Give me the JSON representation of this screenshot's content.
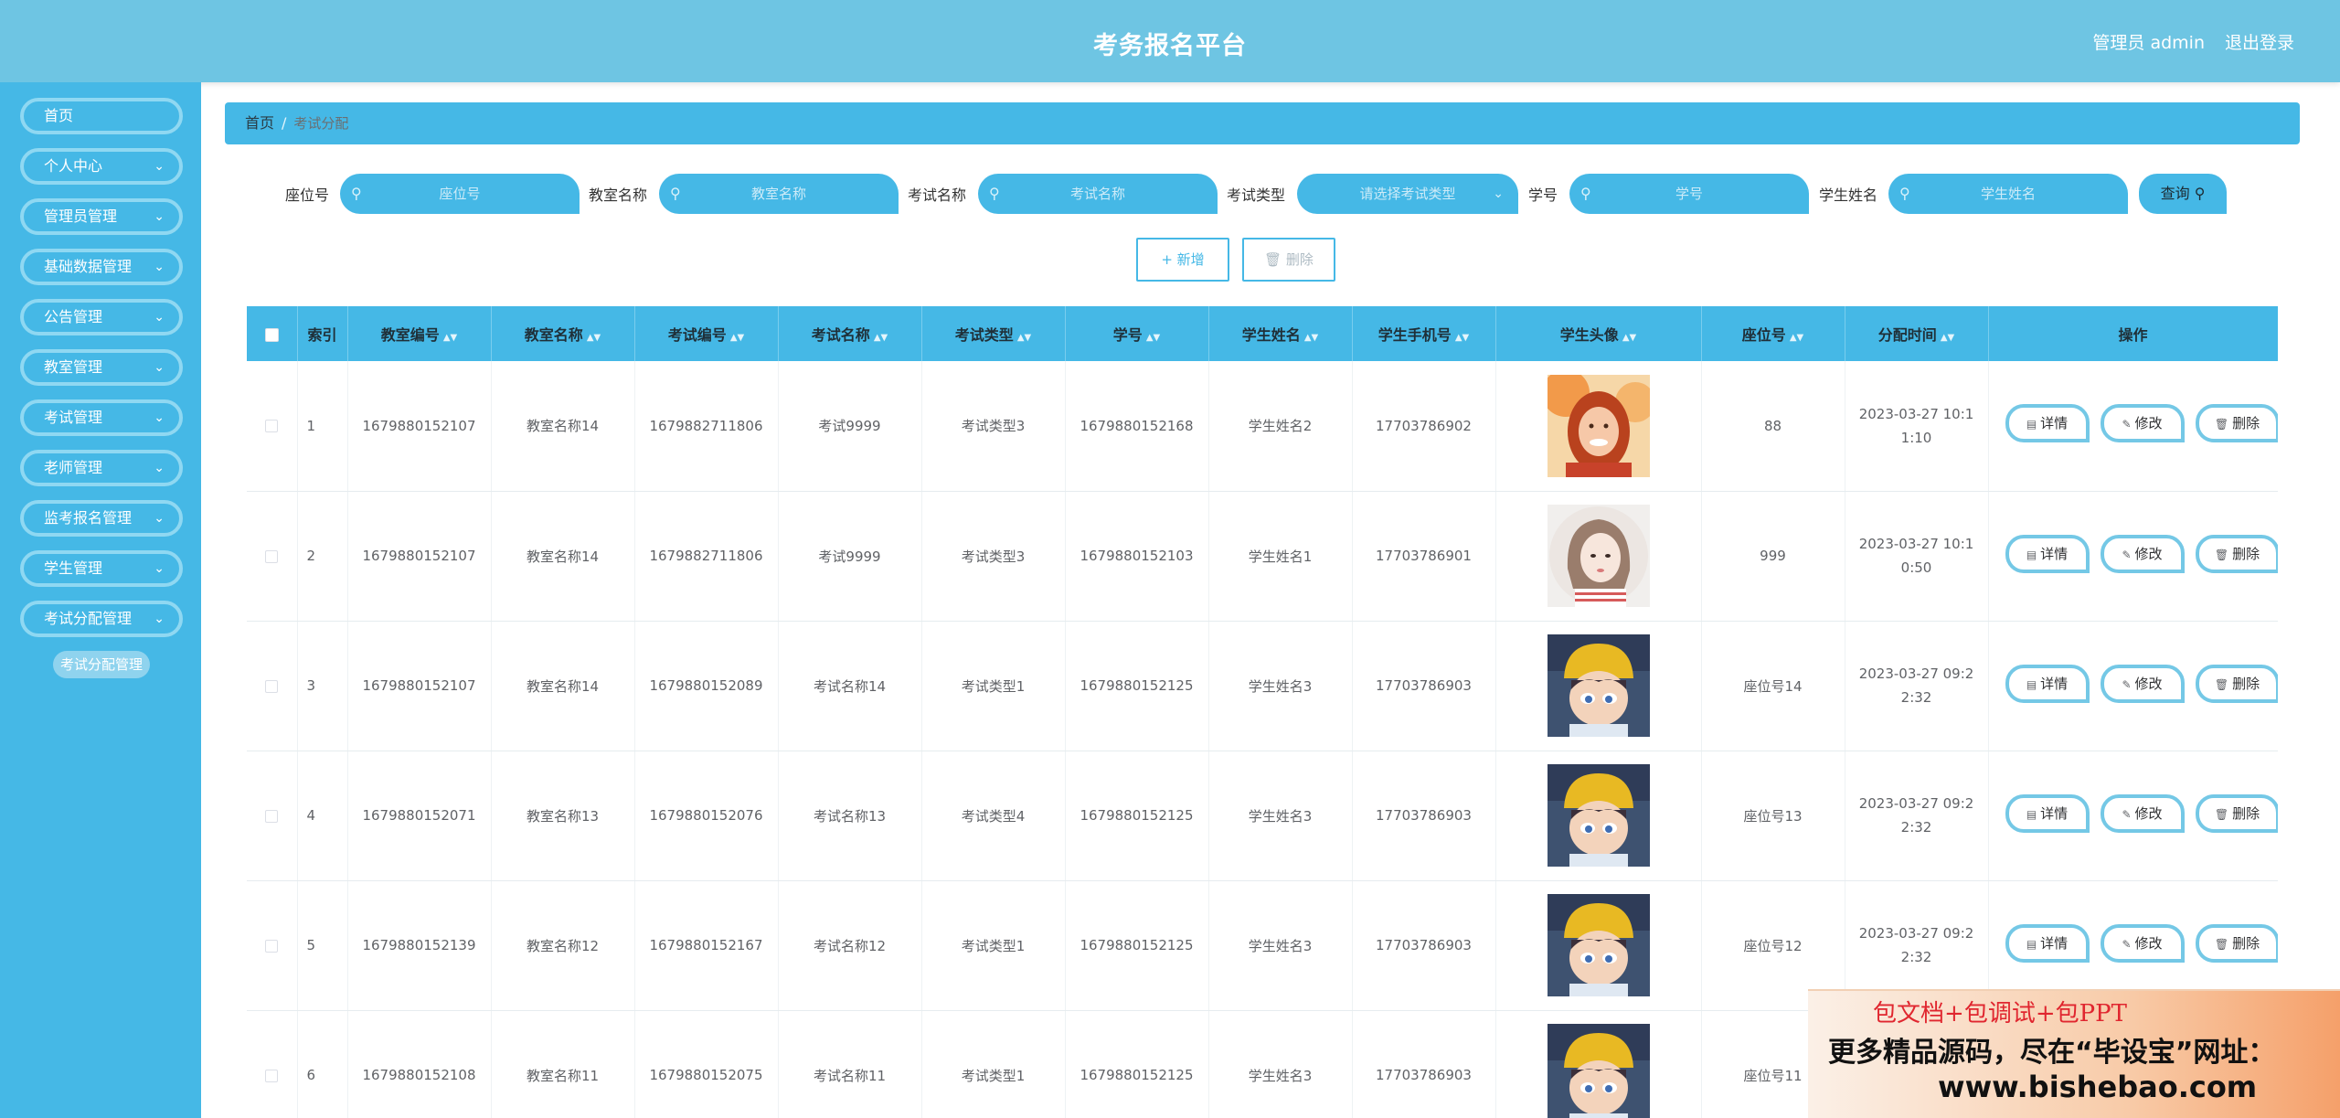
{
  "header": {
    "title": "考务报名平台",
    "user": "管理员 admin",
    "logout": "退出登录"
  },
  "sidebar": {
    "items": [
      {
        "label": "首页",
        "has_arrow": false
      },
      {
        "label": "个人中心",
        "has_arrow": true
      },
      {
        "label": "管理员管理",
        "has_arrow": true
      },
      {
        "label": "基础数据管理",
        "has_arrow": true
      },
      {
        "label": "公告管理",
        "has_arrow": true
      },
      {
        "label": "教室管理",
        "has_arrow": true
      },
      {
        "label": "考试管理",
        "has_arrow": true
      },
      {
        "label": "老师管理",
        "has_arrow": true
      },
      {
        "label": "监考报名管理",
        "has_arrow": true
      },
      {
        "label": "学生管理",
        "has_arrow": true
      },
      {
        "label": "考试分配管理",
        "has_arrow": true
      }
    ],
    "sub_item": "考试分配管理"
  },
  "breadcrumb": {
    "home": "首页",
    "separator": "/",
    "current": "考试分配"
  },
  "search": {
    "seat_label": "座位号",
    "seat_placeholder": "座位号",
    "room_label": "教室名称",
    "room_placeholder": "教室名称",
    "exam_label": "考试名称",
    "exam_placeholder": "考试名称",
    "type_label": "考试类型",
    "type_placeholder": "请选择考试类型",
    "sno_label": "学号",
    "sno_placeholder": "学号",
    "sname_label": "学生姓名",
    "sname_placeholder": "学生姓名",
    "query_label": "查询"
  },
  "actions": {
    "add_label": "新增",
    "delete_label": "删除"
  },
  "table": {
    "columns": [
      "",
      "索引",
      "教室编号",
      "教室名称",
      "考试编号",
      "考试名称",
      "考试类型",
      "学号",
      "学生姓名",
      "学生手机号",
      "学生头像",
      "座位号",
      "分配时间",
      "操作"
    ],
    "row_ops": {
      "detail": "详情",
      "edit": "修改",
      "delete": "删除"
    },
    "rows": [
      {
        "index": "1",
        "room_no": "1679880152107",
        "room_name": "教室名称14",
        "exam_no": "1679882711806",
        "exam_name": "考试9999",
        "exam_type": "考试类型3",
        "student_no": "1679880152168",
        "student_name": "学生姓名2",
        "phone": "17703786902",
        "avatar": "avatar-girl-red",
        "seat": "88",
        "time": "2023-03-27 10:11:10"
      },
      {
        "index": "2",
        "room_no": "1679880152107",
        "room_name": "教室名称14",
        "exam_no": "1679882711806",
        "exam_name": "考试9999",
        "exam_type": "考试类型3",
        "student_no": "1679880152103",
        "student_name": "学生姓名1",
        "phone": "17703786901",
        "avatar": "avatar-girl-sketch",
        "seat": "999",
        "time": "2023-03-27 10:10:50"
      },
      {
        "index": "3",
        "room_no": "1679880152107",
        "room_name": "教室名称14",
        "exam_no": "1679880152089",
        "exam_name": "考试名称14",
        "exam_type": "考试类型1",
        "student_no": "1679880152125",
        "student_name": "学生姓名3",
        "phone": "17703786903",
        "avatar": "avatar-boy-yellow-hat",
        "seat": "座位号14",
        "time": "2023-03-27 09:22:32"
      },
      {
        "index": "4",
        "room_no": "1679880152071",
        "room_name": "教室名称13",
        "exam_no": "1679880152076",
        "exam_name": "考试名称13",
        "exam_type": "考试类型4",
        "student_no": "1679880152125",
        "student_name": "学生姓名3",
        "phone": "17703786903",
        "avatar": "avatar-boy-yellow-hat",
        "seat": "座位号13",
        "time": "2023-03-27 09:22:32"
      },
      {
        "index": "5",
        "room_no": "1679880152139",
        "room_name": "教室名称12",
        "exam_no": "1679880152167",
        "exam_name": "考试名称12",
        "exam_type": "考试类型1",
        "student_no": "1679880152125",
        "student_name": "学生姓名3",
        "phone": "17703786903",
        "avatar": "avatar-boy-yellow-hat",
        "seat": "座位号12",
        "time": "2023-03-27 09:22:32"
      },
      {
        "index": "6",
        "room_no": "1679880152108",
        "room_name": "教室名称11",
        "exam_no": "1679880152075",
        "exam_name": "考试名称11",
        "exam_type": "考试类型1",
        "student_no": "1679880152125",
        "student_name": "学生姓名3",
        "phone": "17703786903",
        "avatar": "avatar-boy-yellow-hat",
        "seat": "座位号11",
        "time": ""
      }
    ]
  },
  "promo": {
    "line1": "包文档+包调试+包PPT",
    "line2": "更多精品源码，尽在“毕设宝”网址：",
    "line3": "www.bishebao.com"
  },
  "colors": {
    "header": "#6ec5e3",
    "sidebar": "#45b8e6",
    "accent": "#45b8e6",
    "button_border": "#74c8e6"
  }
}
